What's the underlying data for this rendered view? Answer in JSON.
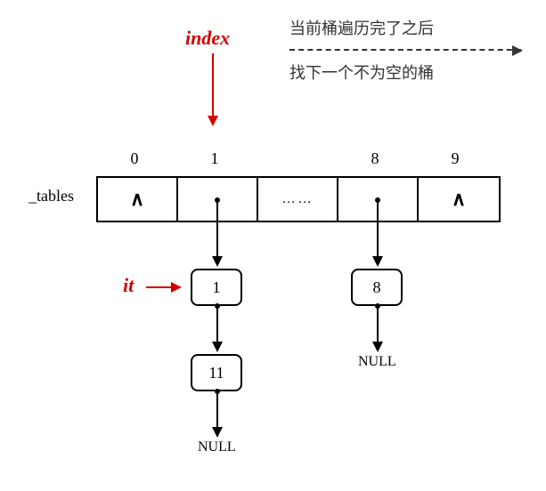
{
  "notes": {
    "line1": "当前桶遍历完了之后",
    "line2": "找下一个不为空的桶"
  },
  "labels": {
    "index": "index",
    "it": "it",
    "tables": "_tables"
  },
  "indices": {
    "c0": "0",
    "c1": "1",
    "c2": "8",
    "c3": "9"
  },
  "cells": {
    "c0": "∧",
    "c1": "",
    "c2": "……",
    "c3": "",
    "c4": "∧"
  },
  "nodes": {
    "n1": "1",
    "n11": "11",
    "n8": "8"
  },
  "nulls": {
    "a": "NULL",
    "b": "NULL"
  },
  "chart_data": {
    "type": "table",
    "title": "Hash table bucket traversal iterator (index / it)",
    "array_label": "_tables",
    "buckets": [
      {
        "index": 0,
        "chain": [],
        "empty_symbol": "∧"
      },
      {
        "index": 1,
        "chain": [
          1,
          11
        ],
        "terminator": "NULL"
      },
      {
        "index": 8,
        "chain": [
          8
        ],
        "terminator": "NULL",
        "preceded_by_ellipsis": true
      },
      {
        "index": 9,
        "chain": [],
        "empty_symbol": "∧"
      }
    ],
    "pointers": {
      "index": 1,
      "it": {
        "bucket": 1,
        "value": 1
      }
    },
    "annotations": [
      "当前桶遍历完了之后",
      "找下一个不为空的桶"
    ]
  }
}
